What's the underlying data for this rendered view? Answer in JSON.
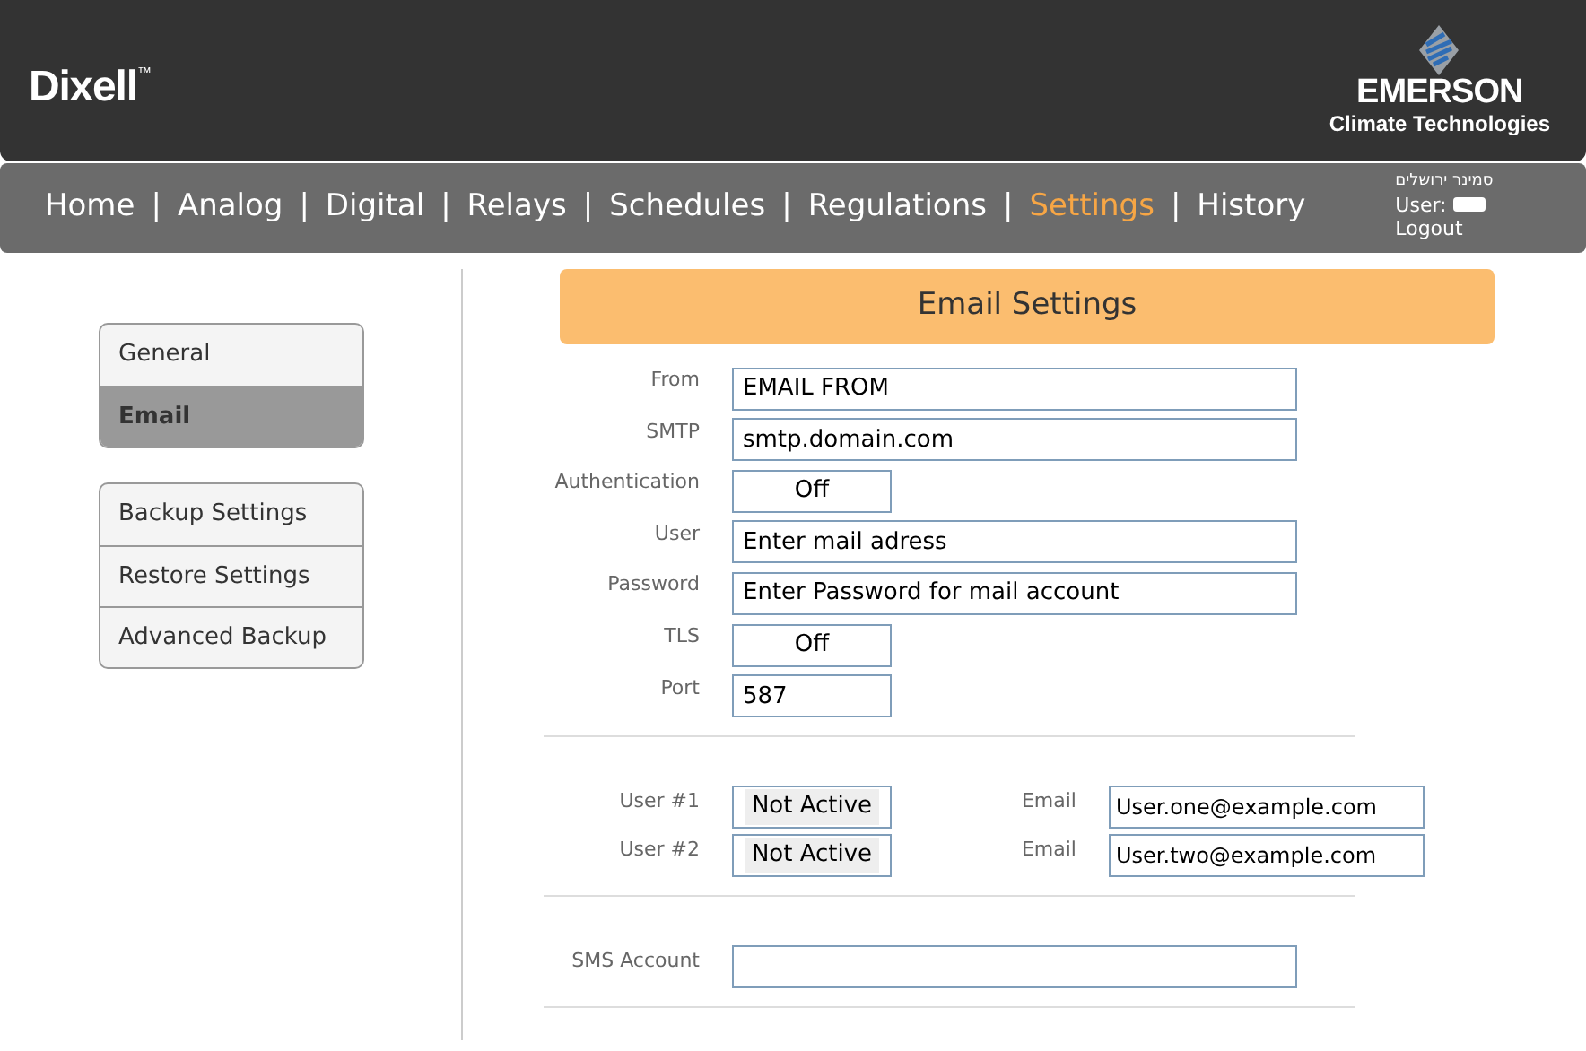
{
  "header": {
    "brand": "Dixell",
    "brand_mark": "™",
    "partner": "EMERSON",
    "partner_sub": "Climate Technologies"
  },
  "nav": [
    {
      "label": "Home",
      "selected": false
    },
    {
      "label": "Analog",
      "selected": false
    },
    {
      "label": "Digital",
      "selected": false
    },
    {
      "label": "Relays",
      "selected": false
    },
    {
      "label": "Schedules",
      "selected": false
    },
    {
      "label": "Regulations",
      "selected": false
    },
    {
      "label": "Settings",
      "selected": true
    },
    {
      "label": "History",
      "selected": false
    }
  ],
  "nav_separator": "|",
  "account": {
    "site": "סמינר ירושלים",
    "user_label": "User:",
    "logout": "Logout"
  },
  "sidebar": [
    [
      {
        "label": "General",
        "selected": false
      },
      {
        "label": "Email",
        "selected": true
      }
    ],
    [
      {
        "label": "Backup Settings",
        "selected": false
      },
      {
        "label": "Restore Settings",
        "selected": false
      },
      {
        "label": "Advanced Backup",
        "selected": false
      }
    ]
  ],
  "title": "Email Settings",
  "fields": [
    {
      "label": "From",
      "kind": "text",
      "value": "EMAIL FROM"
    },
    {
      "label": "SMTP",
      "kind": "text",
      "value": "smtp.domain.com"
    },
    {
      "label": "Authentication",
      "kind": "toggle",
      "value": "Off"
    },
    {
      "label": "User",
      "kind": "text",
      "value": "Enter mail adress"
    },
    {
      "label": "Password",
      "kind": "text",
      "value": "Enter Password for mail account"
    },
    {
      "label": "TLS",
      "kind": "toggle",
      "value": "Off"
    },
    {
      "label": "Port",
      "kind": "short",
      "value": "587"
    }
  ],
  "users": [
    {
      "label": "User #1",
      "status": "Not Active",
      "email_label": "Email",
      "email": "User.one@example.com"
    },
    {
      "label": "User #2",
      "status": "Not Active",
      "email_label": "Email",
      "email": "User.two@example.com"
    }
  ],
  "sms": {
    "label": "SMS Account"
  }
}
